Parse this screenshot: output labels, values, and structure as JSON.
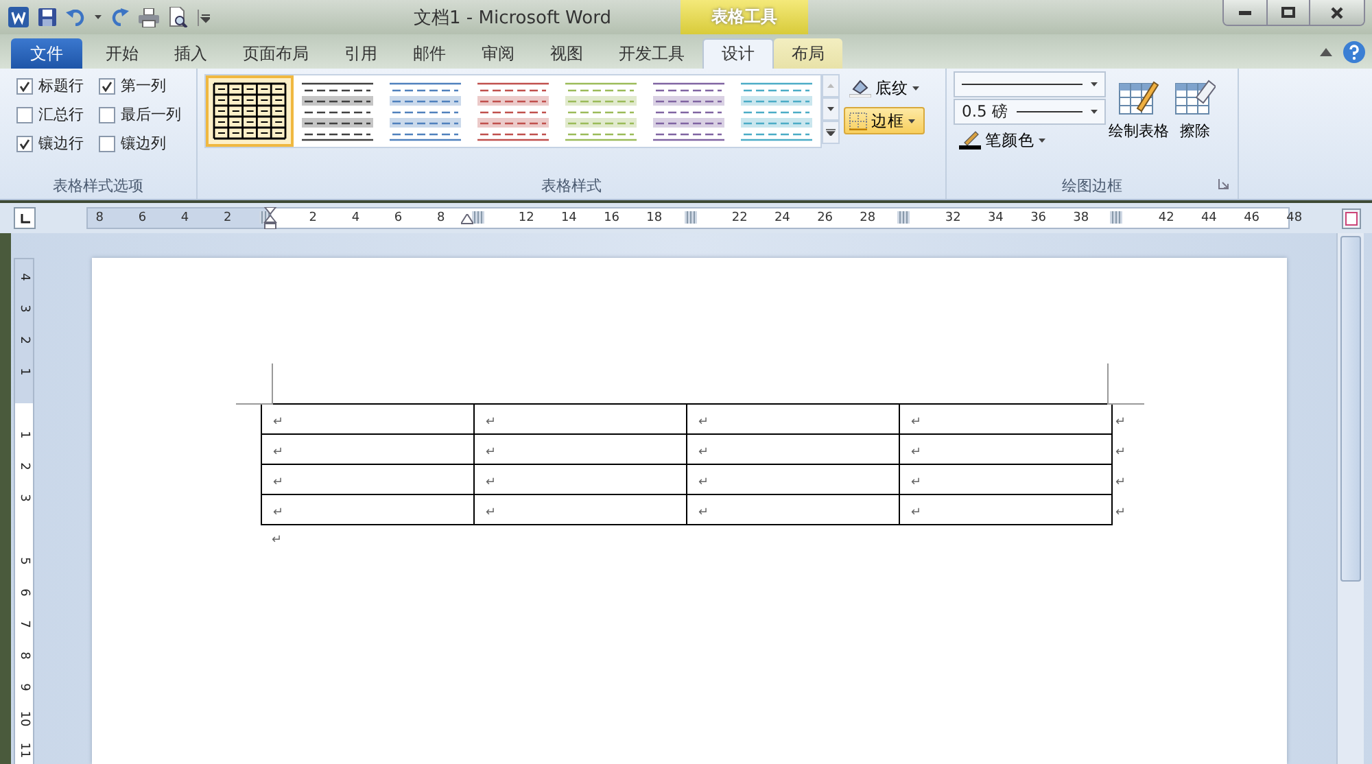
{
  "window": {
    "title": "文档1 - Microsoft Word",
    "contextual_tab": "表格工具"
  },
  "ribbon_tabs": [
    {
      "label": "文件",
      "kind": "file",
      "selected": false
    },
    {
      "label": "开始",
      "kind": "normal",
      "selected": false
    },
    {
      "label": "插入",
      "kind": "normal",
      "selected": false
    },
    {
      "label": "页面布局",
      "kind": "normal",
      "selected": false
    },
    {
      "label": "引用",
      "kind": "normal",
      "selected": false
    },
    {
      "label": "邮件",
      "kind": "normal",
      "selected": false
    },
    {
      "label": "审阅",
      "kind": "normal",
      "selected": false
    },
    {
      "label": "视图",
      "kind": "normal",
      "selected": false
    },
    {
      "label": "开发工具",
      "kind": "normal",
      "selected": false
    },
    {
      "label": "设计",
      "kind": "contextual",
      "selected": true
    },
    {
      "label": "布局",
      "kind": "contextual",
      "selected": false
    }
  ],
  "table_style_options": {
    "label": "表格样式选项",
    "options": [
      {
        "label": "标题行",
        "checked": true
      },
      {
        "label": "第一列",
        "checked": true
      },
      {
        "label": "汇总行",
        "checked": false
      },
      {
        "label": "最后一列",
        "checked": false
      },
      {
        "label": "镶边行",
        "checked": true
      },
      {
        "label": "镶边列",
        "checked": false
      }
    ]
  },
  "table_styles": {
    "label": "表格样式",
    "styles": [
      {
        "kind": "grid",
        "color": "#000000",
        "selected": true
      },
      {
        "kind": "banded",
        "color": "#404040",
        "selected": false
      },
      {
        "kind": "banded",
        "color": "#4f81bd",
        "selected": false
      },
      {
        "kind": "banded",
        "color": "#c0504d",
        "selected": false
      },
      {
        "kind": "banded",
        "color": "#9bbb59",
        "selected": false
      },
      {
        "kind": "banded",
        "color": "#8064a2",
        "selected": false
      },
      {
        "kind": "banded",
        "color": "#4bacc6",
        "selected": false
      }
    ],
    "shading_button": {
      "label": "底纹",
      "on": false
    },
    "borders_button": {
      "label": "边框",
      "on": true
    }
  },
  "draw_borders": {
    "label": "绘图边框",
    "line_weight": "0.5 磅",
    "pen_color": "笔颜色",
    "draw_table": "绘制表格",
    "eraser": "擦除"
  },
  "horizontal_ruler": [
    "8",
    "6",
    "4",
    "2",
    "2",
    "4",
    "6",
    "8",
    "12",
    "14",
    "16",
    "18",
    "22",
    "24",
    "26",
    "28",
    "32",
    "34",
    "36",
    "38",
    "42",
    "44",
    "46",
    "48"
  ],
  "vertical_ruler": [
    "4",
    "3",
    "2",
    "1",
    "1",
    "2",
    "3",
    "5",
    "6",
    "7",
    "8",
    "9",
    "10",
    "11"
  ],
  "document": {
    "table": {
      "rows": [
        {
          "cells": [
            "↵",
            "↵",
            "↵",
            "↵"
          ],
          "end_mark": "↵"
        },
        {
          "cells": [
            "↵",
            "↵",
            "↵",
            "↵"
          ],
          "end_mark": "↵"
        },
        {
          "cells": [
            "↵",
            "↵",
            "↵",
            "↵"
          ],
          "end_mark": "↵"
        },
        {
          "cells": [
            "↵",
            "↵",
            "↵",
            "↵"
          ],
          "end_mark": "↵"
        }
      ]
    },
    "paragraph_mark": "↵"
  }
}
